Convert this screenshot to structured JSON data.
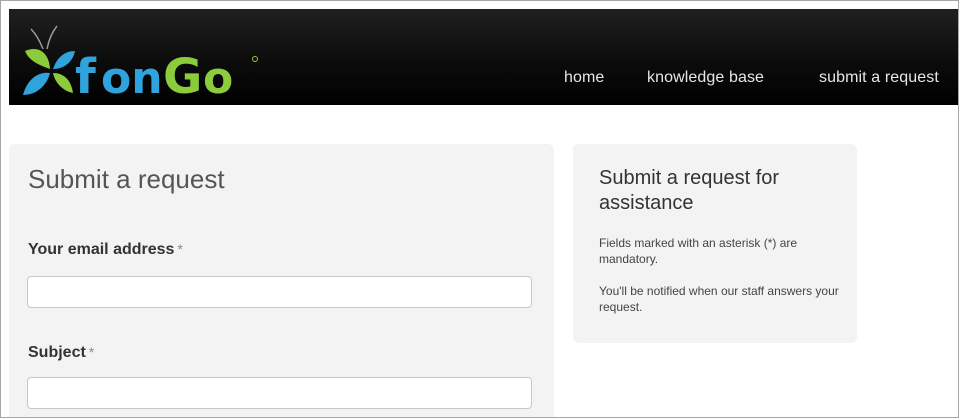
{
  "brand": {
    "name": "fongo",
    "logo_text": "fonGo",
    "colors": {
      "blue": "#2fa3dc",
      "green": "#8ccb3c",
      "header_bg": "#0c0c0c"
    }
  },
  "nav": {
    "items": [
      {
        "label": "home"
      },
      {
        "label": "knowledge base"
      },
      {
        "label": "submit a request"
      }
    ]
  },
  "form": {
    "title": "Submit a request",
    "email_label": "Your email address",
    "email_value": "",
    "subject_label": "Subject",
    "subject_value": "",
    "required_marker": "*"
  },
  "sidebar": {
    "title": "Submit a request for assistance",
    "text1": "Fields marked with an asterisk (*) are mandatory.",
    "text2": "You'll be notified when our staff answers your request."
  }
}
